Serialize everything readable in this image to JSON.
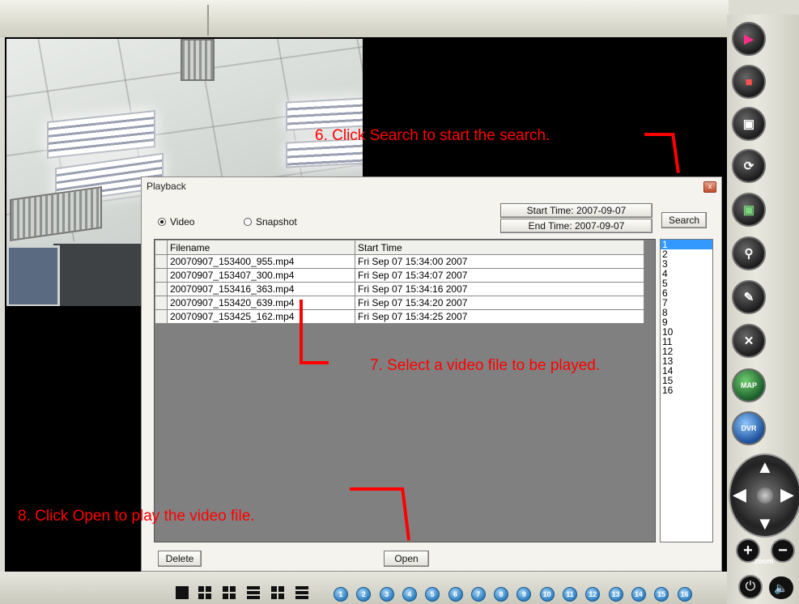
{
  "dialog": {
    "title": "Playback",
    "close_label": "x",
    "radio_video": "Video",
    "radio_snapshot": "Snapshot",
    "start_time": "Start Time: 2007-09-07",
    "end_time": "End Time: 2007-09-07",
    "search_label": "Search",
    "delete_label": "Delete",
    "open_label": "Open",
    "columns": [
      "Filename",
      "Start Time"
    ],
    "files": [
      {
        "name": "20070907_153400_955.mp4",
        "time": "Fri Sep 07 15:34:00 2007"
      },
      {
        "name": "20070907_153407_300.mp4",
        "time": "Fri Sep 07 15:34:07 2007"
      },
      {
        "name": "20070907_153416_363.mp4",
        "time": "Fri Sep 07 15:34:16 2007"
      },
      {
        "name": "20070907_153420_639.mp4",
        "time": "Fri Sep 07 15:34:20 2007"
      },
      {
        "name": "20070907_153425_162.mp4",
        "time": "Fri Sep 07 15:34:25 2007"
      }
    ],
    "channels": [
      "1",
      "2",
      "3",
      "4",
      "5",
      "6",
      "7",
      "8",
      "9",
      "10",
      "11",
      "12",
      "13",
      "14",
      "15",
      "16"
    ]
  },
  "annotations": {
    "step6": "6. Click Search to start the search.",
    "step7": "7. Select a video file to be played.",
    "step8": "8. Click Open to play the video file."
  },
  "sidebar": {
    "buttons": [
      "play-icon",
      "record-icon",
      "snapshot-icon",
      "rotate-180-icon",
      "fullscreen-icon",
      "lock-icon",
      "edit-icon",
      "settings-tools-icon",
      "map-icon",
      "dvr-icon"
    ],
    "map_label": "MAP",
    "dvr_label": "DVR",
    "zoom_label": "zoom"
  },
  "bottombar": {
    "channels": [
      "1",
      "2",
      "3",
      "4",
      "5",
      "6",
      "7",
      "8",
      "9",
      "10",
      "11",
      "12",
      "13",
      "14",
      "15",
      "16"
    ]
  },
  "colors": {
    "annotation": "#ff0000",
    "channel_button": "#2c7fc2",
    "selected_channel": "#3399ff"
  }
}
